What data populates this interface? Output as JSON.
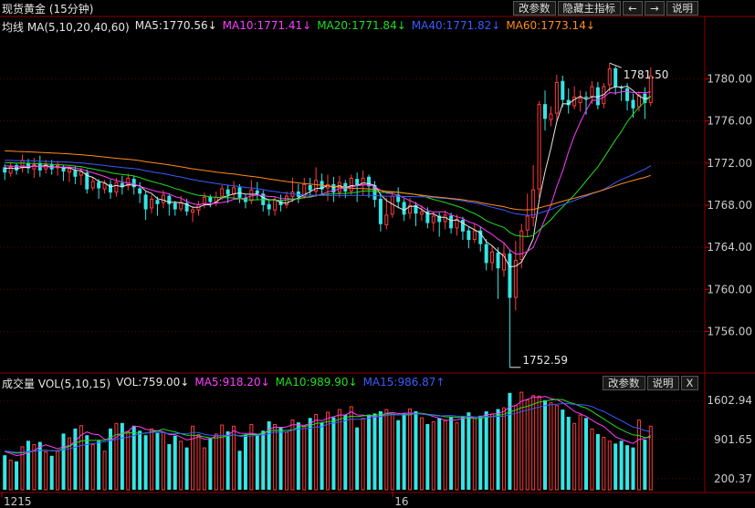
{
  "header": {
    "title": "现货黄金 (15分钟)",
    "buttons": [
      "改参数",
      "隐藏主指标"
    ],
    "nav_left": "←",
    "nav_right": "→",
    "help": "说明"
  },
  "ma_legend": {
    "label": "均线 MA(5,10,20,40,60)",
    "items": [
      {
        "text": "MA5:1770.56↓",
        "color": "#e6e6e6"
      },
      {
        "text": "MA10:1771.41↓",
        "color": "#ff3cff"
      },
      {
        "text": "MA20:1771.84↓",
        "color": "#22dd22"
      },
      {
        "text": "MA40:1771.82↓",
        "color": "#3b5bff"
      },
      {
        "text": "MA60:1773.14↓",
        "color": "#ff8c1a"
      }
    ]
  },
  "vol_legend": {
    "label": "成交量 VOL(5,10,15)",
    "items": [
      {
        "text": "VOL:759.00↓",
        "color": "#e6e6e6"
      },
      {
        "text": "MA5:918.20↓",
        "color": "#ff3cff"
      },
      {
        "text": "MA10:989.90↓",
        "color": "#22dd22"
      },
      {
        "text": "MA15:986.87↑",
        "color": "#3b5bff"
      }
    ],
    "buttons": [
      "改参数",
      "说明",
      "X"
    ]
  },
  "chart_data": {
    "type": "candlestick",
    "price_axis": {
      "ylim": [
        1752.4,
        1784.2
      ],
      "ticks": [
        1780,
        1776,
        1772,
        1768,
        1764,
        1760,
        1756
      ],
      "tick_labels": [
        "1780.00",
        "1776.00",
        "1772.00",
        "1768.00",
        "1764.00",
        "1760.00",
        "1756.00"
      ]
    },
    "volume_axis": {
      "ylim": [
        0,
        1802
      ],
      "ticks": [
        1602.94,
        901.65,
        200.37
      ],
      "tick_labels": [
        "1602.94",
        "901.65",
        "200.37"
      ]
    },
    "x_labels": [
      {
        "index": 0,
        "text": "1215"
      },
      {
        "index": 67,
        "text": "16"
      }
    ],
    "annotations": {
      "high": "1781.50",
      "low": "1752.59"
    },
    "candles": [
      [
        1771.6,
        1771.1,
        1770.4,
        1771.9,
        620
      ],
      [
        1771.0,
        1771.7,
        1770.7,
        1772.1,
        540
      ],
      [
        1771.8,
        1771.3,
        1770.9,
        1772.0,
        510
      ],
      [
        1771.5,
        1772.3,
        1771.1,
        1772.8,
        780
      ],
      [
        1772.0,
        1771.5,
        1771.0,
        1772.4,
        880
      ],
      [
        1771.4,
        1771.9,
        1770.6,
        1772.5,
        820
      ],
      [
        1772.0,
        1771.3,
        1770.7,
        1772.7,
        860
      ],
      [
        1771.4,
        1771.9,
        1771.0,
        1772.3,
        690
      ],
      [
        1771.9,
        1771.4,
        1770.9,
        1772.3,
        610
      ],
      [
        1771.5,
        1771.8,
        1770.8,
        1772.2,
        700
      ],
      [
        1771.6,
        1771.2,
        1770.3,
        1771.8,
        1010
      ],
      [
        1771.1,
        1771.5,
        1770.2,
        1771.7,
        940
      ],
      [
        1771.3,
        1770.7,
        1770.0,
        1771.7,
        1100
      ],
      [
        1770.8,
        1771.2,
        1769.9,
        1771.6,
        1160
      ],
      [
        1771.1,
        1769.5,
        1769.1,
        1771.4,
        980
      ],
      [
        1769.6,
        1770.3,
        1769.4,
        1770.7,
        820
      ],
      [
        1770.2,
        1769.6,
        1768.6,
        1770.5,
        880
      ],
      [
        1769.5,
        1770.1,
        1769.1,
        1770.4,
        700
      ],
      [
        1770.0,
        1769.2,
        1768.6,
        1770.4,
        1100
      ],
      [
        1769.2,
        1770.2,
        1768.8,
        1770.6,
        1200
      ],
      [
        1770.1,
        1769.7,
        1769.0,
        1770.8,
        1200
      ],
      [
        1769.8,
        1770.6,
        1769.4,
        1771.0,
        1050
      ],
      [
        1770.5,
        1769.7,
        1769.0,
        1770.8,
        1150
      ],
      [
        1769.6,
        1769.1,
        1768.2,
        1770.2,
        1060
      ],
      [
        1769.0,
        1767.6,
        1766.6,
        1769.3,
        980
      ],
      [
        1767.7,
        1768.6,
        1767.2,
        1769.0,
        1100
      ],
      [
        1768.5,
        1768.1,
        1767.0,
        1768.8,
        1020
      ],
      [
        1768.2,
        1769.0,
        1767.7,
        1769.4,
        1040
      ],
      [
        1768.9,
        1768.1,
        1767.0,
        1769.0,
        820
      ],
      [
        1768.2,
        1767.6,
        1767.0,
        1768.4,
        970
      ],
      [
        1767.6,
        1768.3,
        1767.4,
        1768.9,
        880
      ],
      [
        1768.2,
        1767.4,
        1767.0,
        1768.6,
        760
      ],
      [
        1767.3,
        1767.6,
        1766.4,
        1767.9,
        1150
      ],
      [
        1767.5,
        1768.1,
        1767.0,
        1768.4,
        1000
      ],
      [
        1768.1,
        1768.8,
        1767.7,
        1769.2,
        760
      ],
      [
        1768.8,
        1768.3,
        1767.8,
        1769.0,
        920
      ],
      [
        1768.2,
        1768.8,
        1767.9,
        1769.3,
        1010
      ],
      [
        1768.8,
        1769.6,
        1768.5,
        1769.9,
        1170
      ],
      [
        1769.5,
        1769.0,
        1768.2,
        1769.9,
        1050
      ],
      [
        1769.0,
        1769.7,
        1768.6,
        1770.3,
        1150
      ],
      [
        1769.7,
        1768.7,
        1768.2,
        1770.0,
        700
      ],
      [
        1768.7,
        1768.3,
        1767.7,
        1769.0,
        990
      ],
      [
        1768.4,
        1769.5,
        1768.1,
        1770.4,
        1180
      ],
      [
        1769.4,
        1769.1,
        1768.5,
        1770.2,
        980
      ],
      [
        1769.1,
        1768.0,
        1767.4,
        1769.4,
        1060
      ],
      [
        1768.1,
        1767.6,
        1767.0,
        1768.6,
        1230
      ],
      [
        1767.5,
        1768.5,
        1767.0,
        1768.8,
        1180
      ],
      [
        1768.4,
        1768.0,
        1767.4,
        1769.0,
        1130
      ],
      [
        1768.0,
        1768.9,
        1767.7,
        1769.3,
        1040
      ],
      [
        1768.8,
        1769.3,
        1768.3,
        1770.6,
        1260
      ],
      [
        1769.3,
        1768.8,
        1768.2,
        1770.0,
        1210
      ],
      [
        1768.8,
        1770.0,
        1768.6,
        1770.6,
        1140
      ],
      [
        1769.9,
        1769.4,
        1768.9,
        1770.6,
        1290
      ],
      [
        1769.3,
        1770.4,
        1768.8,
        1771.6,
        1360
      ],
      [
        1770.3,
        1769.5,
        1769.0,
        1771.0,
        1210
      ],
      [
        1769.6,
        1770.0,
        1768.4,
        1770.9,
        1400
      ],
      [
        1770.0,
        1769.2,
        1768.3,
        1770.7,
        1300
      ],
      [
        1769.2,
        1770.2,
        1768.7,
        1770.8,
        1450
      ],
      [
        1770.1,
        1769.3,
        1768.7,
        1770.4,
        1350
      ],
      [
        1769.3,
        1770.6,
        1769.0,
        1770.9,
        1500
      ],
      [
        1770.5,
        1769.9,
        1768.3,
        1771.1,
        1120
      ],
      [
        1769.9,
        1770.6,
        1768.9,
        1771.3,
        1290
      ],
      [
        1770.7,
        1769.8,
        1768.7,
        1770.9,
        1350
      ],
      [
        1769.9,
        1768.5,
        1767.8,
        1770.3,
        1370
      ],
      [
        1768.6,
        1766.2,
        1765.5,
        1769.1,
        1410
      ],
      [
        1766.1,
        1767.1,
        1765.7,
        1768.7,
        1450
      ],
      [
        1767.1,
        1768.9,
        1766.8,
        1769.3,
        1360
      ],
      [
        1769.0,
        1768.3,
        1767.7,
        1769.7,
        1250
      ],
      [
        1768.3,
        1767.1,
        1766.5,
        1768.6,
        1380
      ],
      [
        1767.2,
        1768.0,
        1766.7,
        1768.7,
        1460
      ],
      [
        1768.0,
        1767.2,
        1766.0,
        1768.3,
        1410
      ],
      [
        1767.1,
        1767.4,
        1766.5,
        1768.0,
        1300
      ],
      [
        1767.4,
        1766.3,
        1765.8,
        1767.8,
        1180
      ],
      [
        1766.3,
        1767.0,
        1765.5,
        1767.4,
        1230
      ],
      [
        1767.0,
        1766.4,
        1765.0,
        1767.3,
        1290
      ],
      [
        1766.4,
        1767.1,
        1765.7,
        1767.5,
        1250
      ],
      [
        1767.0,
        1765.8,
        1765.3,
        1767.3,
        1310
      ],
      [
        1765.8,
        1766.7,
        1765.1,
        1767.1,
        1210
      ],
      [
        1766.6,
        1765.5,
        1764.7,
        1766.9,
        1320
      ],
      [
        1765.6,
        1764.7,
        1763.9,
        1765.9,
        1390
      ],
      [
        1764.7,
        1765.6,
        1764.4,
        1766.3,
        1290
      ],
      [
        1765.6,
        1764.3,
        1763.6,
        1766.0,
        1330
      ],
      [
        1764.3,
        1762.5,
        1761.8,
        1764.8,
        1410
      ],
      [
        1762.5,
        1763.6,
        1761.8,
        1764.1,
        1370
      ],
      [
        1763.5,
        1762.0,
        1759.1,
        1764.0,
        1450
      ],
      [
        1761.8,
        1763.4,
        1761.2,
        1764.4,
        1480
      ],
      [
        1763.4,
        1759.2,
        1752.59,
        1763.8,
        1740
      ],
      [
        1759.2,
        1762.8,
        1758.0,
        1764.6,
        1520
      ],
      [
        1762.8,
        1765.6,
        1762.0,
        1766.2,
        1760
      ],
      [
        1765.6,
        1767.0,
        1765.0,
        1769.1,
        1620
      ],
      [
        1766.8,
        1769.5,
        1766.0,
        1771.8,
        1700
      ],
      [
        1769.5,
        1777.6,
        1768.7,
        1777.9,
        1690
      ],
      [
        1777.6,
        1776.2,
        1775.1,
        1778.9,
        1610
      ],
      [
        1776.1,
        1776.7,
        1775.5,
        1777.4,
        1570
      ],
      [
        1776.7,
        1779.7,
        1776.1,
        1780.4,
        1520
      ],
      [
        1779.8,
        1778.0,
        1777.3,
        1780.3,
        1440
      ],
      [
        1778.0,
        1777.5,
        1776.7,
        1779.1,
        1310
      ],
      [
        1777.4,
        1778.3,
        1777.1,
        1779.3,
        1200
      ],
      [
        1777.7,
        1778.2,
        1776.9,
        1778.9,
        1350
      ],
      [
        1778.3,
        1778.2,
        1776.6,
        1778.8,
        1290
      ],
      [
        1778.3,
        1779.3,
        1777.6,
        1779.8,
        1100
      ],
      [
        1779.2,
        1777.5,
        1777.1,
        1779.7,
        1000
      ],
      [
        1777.6,
        1779.3,
        1777.2,
        1779.6,
        950
      ],
      [
        1779.4,
        1781.0,
        1778.8,
        1781.5,
        880
      ],
      [
        1781.0,
        1779.2,
        1778.5,
        1781.2,
        830
      ],
      [
        1779.2,
        1779.1,
        1777.9,
        1779.4,
        880
      ],
      [
        1779.1,
        1777.9,
        1777.0,
        1779.6,
        800
      ],
      [
        1778.0,
        1777.2,
        1776.3,
        1778.6,
        760
      ],
      [
        1777.3,
        1778.5,
        1776.9,
        1778.8,
        1260
      ],
      [
        1778.6,
        1777.7,
        1776.2,
        1779.2,
        900
      ],
      [
        1777.7,
        1780.3,
        1777.4,
        1781.1,
        1150
      ]
    ]
  }
}
